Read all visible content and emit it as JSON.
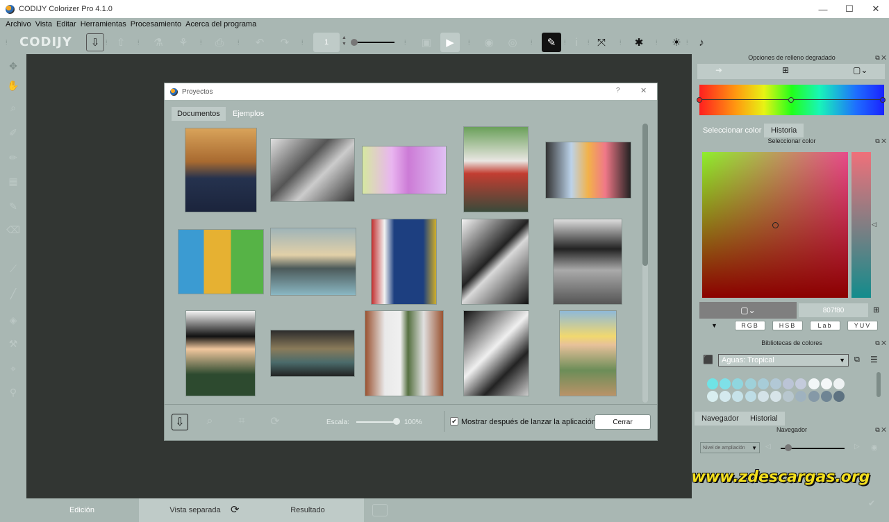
{
  "window": {
    "title": "CODIJY Colorizer Pro 4.1.0",
    "min": "—",
    "max": "☐",
    "close": "✕"
  },
  "menu": [
    "Archivo",
    "Vista",
    "Editar",
    "Herramientas",
    "Procesamiento",
    "Acerca del programa"
  ],
  "toolbar": {
    "logo": "CODIJY",
    "zoom_value": "1"
  },
  "bottom_tabs": {
    "edit": "Edición",
    "split": "Vista separada",
    "result": "Resultado"
  },
  "right": {
    "gradient_title": "Opciones de relleno degradado",
    "tabs1": {
      "select_color": "Seleccionar color",
      "history": "Historia"
    },
    "select_color_title": "Seleccionar color",
    "hex": "807f80",
    "modes": [
      "RGB",
      "HSB",
      "Lab",
      "YUV"
    ],
    "libraries_title": "Bibliotecas de colores",
    "library_value": "Aguas: Tropical",
    "swatches_row1": [
      "#6fe3e6",
      "#7ee0e8",
      "#8fd6df",
      "#9ed1da",
      "#a7ccd8",
      "#b2c8d6",
      "#bbc4d6",
      "#c4cbdc",
      "#f2f6f7",
      "#f4f7f8",
      "#eef2f3"
    ],
    "swatches_row2": [
      "#d8eef0",
      "#d4e9ee",
      "#c6e2e9",
      "#bedde6",
      "#d3e2e8",
      "#d7e4e9",
      "#b8c7cf",
      "#9fb2bf",
      "#8599a7",
      "#6f8594",
      "#5d7281"
    ],
    "tabs2": {
      "navigator": "Navegador",
      "history": "Historial"
    },
    "navigator_title": "Navegador",
    "zoom_select": "Nivel de ampliación"
  },
  "dialog": {
    "title": "Proyectos",
    "help": "?",
    "close": "✕",
    "tabs": {
      "documents": "Documentos",
      "examples": "Ejemplos"
    },
    "scale_label": "Escala:",
    "scale_value": "100%",
    "show_after_launch": "Mostrar después de lanzar la aplicación",
    "close_button": "Cerrar"
  },
  "watermark": "www.zdescargas.org"
}
